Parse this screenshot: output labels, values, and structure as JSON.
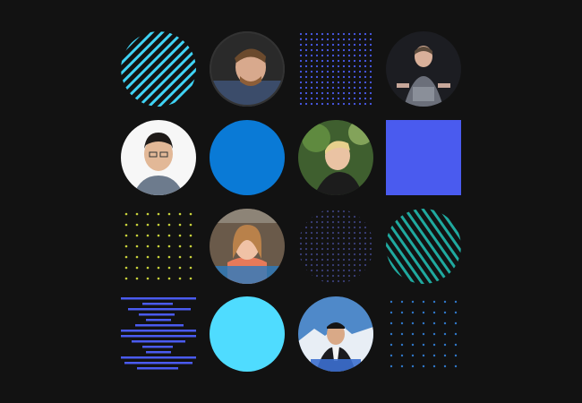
{
  "colors": {
    "background": "#121212",
    "cyan": "#3fd3f5",
    "blue": "#0a7ad6",
    "indigo": "#4a5bef",
    "teal": "#1fa99f",
    "yellow": "#c8d23a",
    "light_cyan": "#4fdcff",
    "navy_dots": "#3a3f78"
  },
  "tiles": [
    {
      "kind": "striped-circle",
      "color": "cyan"
    },
    {
      "kind": "avatar",
      "icon": "person-photo-1"
    },
    {
      "kind": "dot-square",
      "color": "indigo"
    },
    {
      "kind": "avatar",
      "icon": "person-photo-2"
    },
    {
      "kind": "avatar",
      "icon": "person-photo-3"
    },
    {
      "kind": "solid-circle",
      "color": "blue"
    },
    {
      "kind": "avatar",
      "icon": "person-photo-4"
    },
    {
      "kind": "solid-square",
      "color": "indigo"
    },
    {
      "kind": "dot-grid",
      "color": "yellow"
    },
    {
      "kind": "avatar",
      "icon": "person-photo-5"
    },
    {
      "kind": "dot-circle",
      "color": "navy_dots"
    },
    {
      "kind": "striped-circle",
      "color": "teal"
    },
    {
      "kind": "line-stack",
      "color": "indigo"
    },
    {
      "kind": "solid-circle",
      "color": "light_cyan"
    },
    {
      "kind": "avatar",
      "icon": "person-photo-6"
    },
    {
      "kind": "dot-grid",
      "color": "indigo"
    }
  ]
}
